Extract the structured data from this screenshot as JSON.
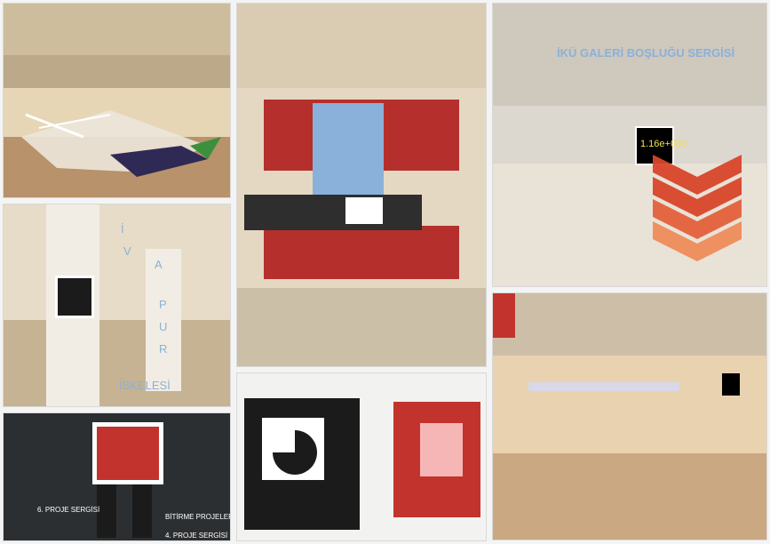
{
  "collage": {
    "panels": [
      {
        "name": "atrium-sculpture-panel",
        "labels": []
      },
      {
        "name": "atrium-poster-panel",
        "labels": []
      },
      {
        "name": "gallery-exhibition-panel",
        "labels": [
          "İKÜ GALERİ BOŞLUĞU SERGİSİ",
          "1.16e+003"
        ]
      },
      {
        "name": "column-marker-panel",
        "labels": [
          "İ",
          "V",
          "A",
          "P",
          "U",
          "R",
          "İSKELESİ"
        ]
      },
      {
        "name": "upper-atrium-panel",
        "labels": []
      },
      {
        "name": "elevator-panel",
        "labels": [
          "6. PROJE SERGİSİ",
          "BİTİRME PROJELERİ",
          "4. PROJE SERGİSİ"
        ]
      },
      {
        "name": "marker-cards-panel",
        "labels": []
      }
    ]
  },
  "colors": {
    "accent_red": "#c3332d",
    "wall_cream": "#e9dcc2",
    "floor_tan": "#c9b79a",
    "exhibit_blue": "#8ab1d9",
    "marker_black": "#1b1b1b"
  }
}
